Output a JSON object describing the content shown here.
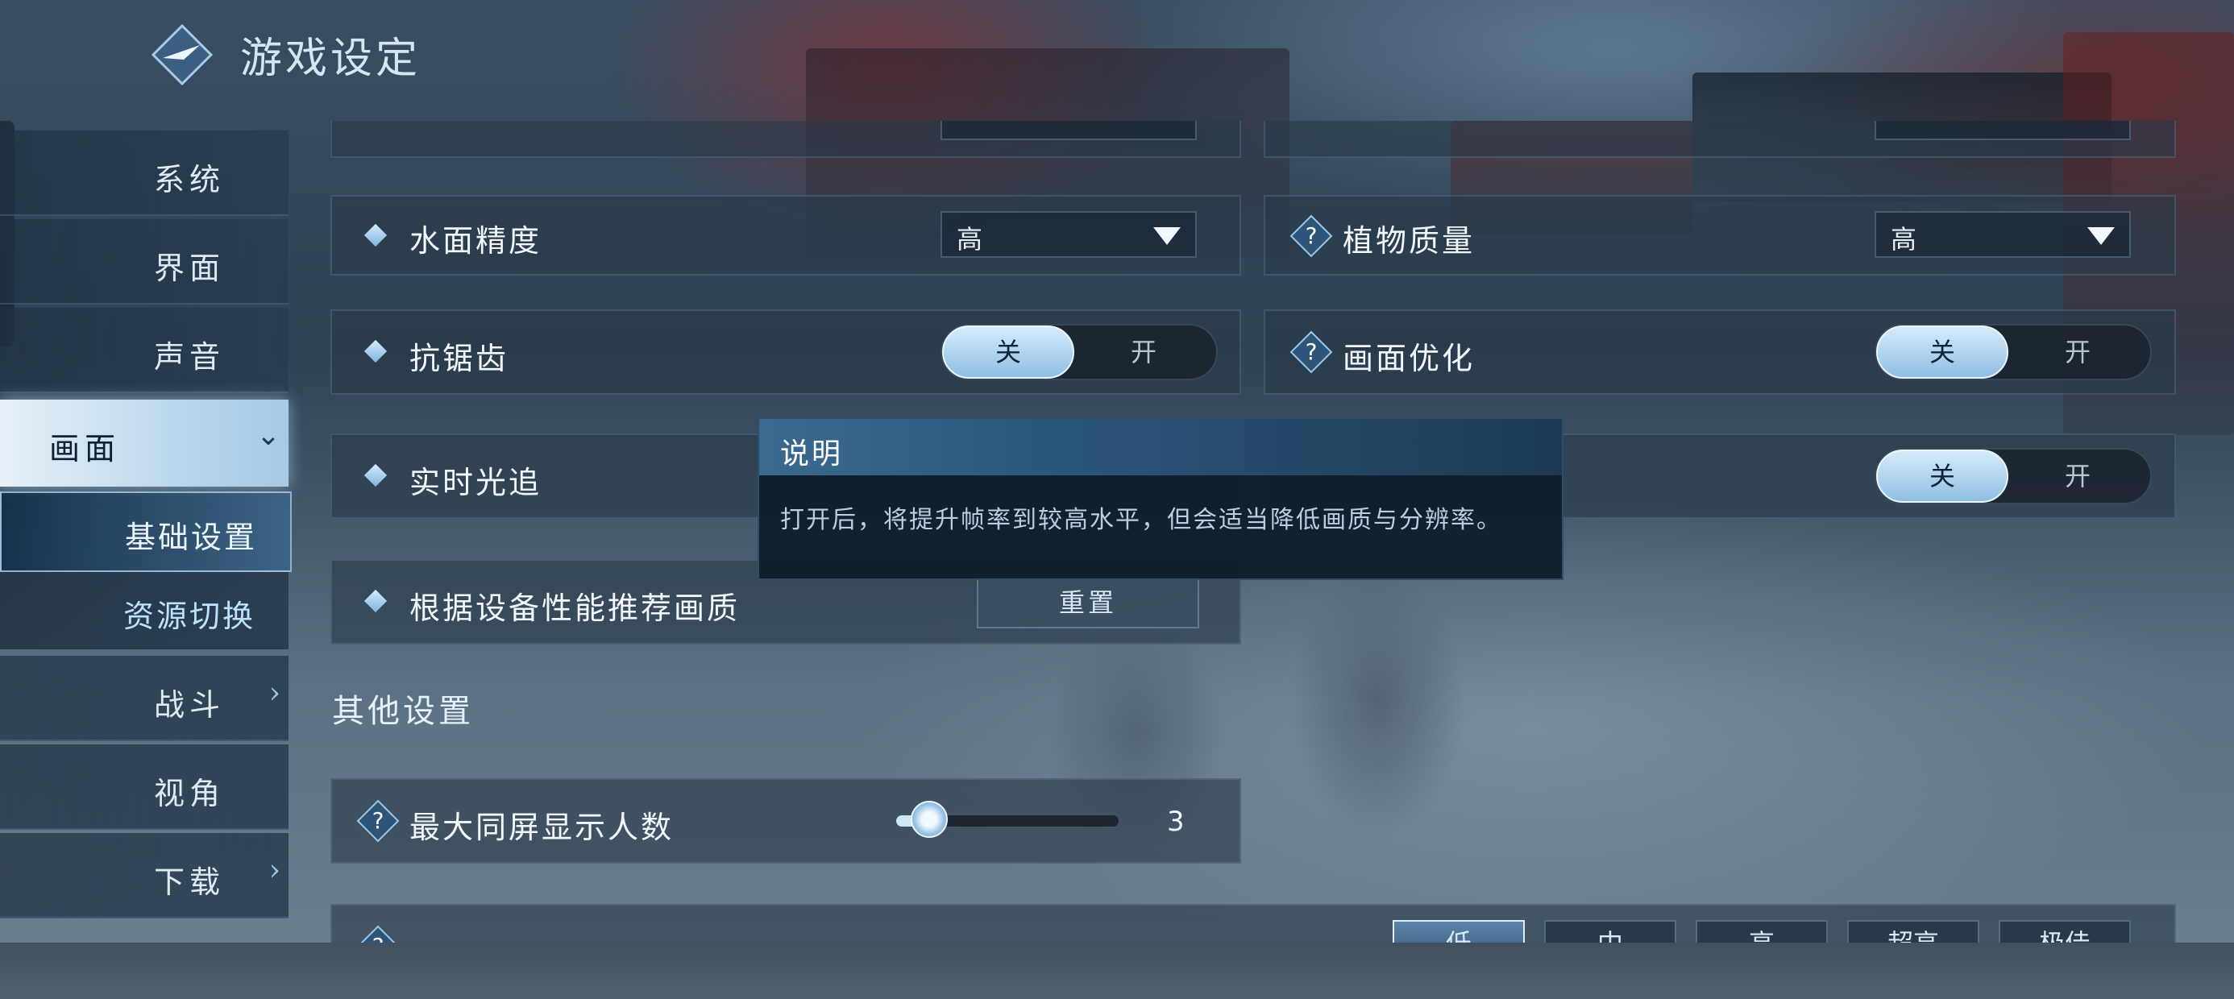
{
  "title": "游戏设定",
  "sidebar": {
    "items": [
      {
        "label": "系统"
      },
      {
        "label": "界面"
      },
      {
        "label": "声音"
      },
      {
        "label": "画面"
      },
      {
        "label": "战斗"
      },
      {
        "label": "视角"
      },
      {
        "label": "下载"
      }
    ],
    "subitems": [
      {
        "label": "基础设置"
      },
      {
        "label": "资源切换"
      }
    ],
    "active": "画面",
    "active_sub": "基础设置"
  },
  "settings": {
    "water": {
      "label": "水面精度",
      "value": "高"
    },
    "plant": {
      "label": "植物质量",
      "value": "高"
    },
    "aa": {
      "label": "抗锯齿",
      "on": "关",
      "off": "开"
    },
    "opt": {
      "label": "画面优化",
      "on": "关",
      "off": "开"
    },
    "rt": {
      "label": "实时光追"
    },
    "rt_right": {
      "on": "关",
      "off": "开"
    },
    "recommend": {
      "label": "根据设备性能推荐画质",
      "button": "重置"
    }
  },
  "other": {
    "section_title": "其他设置",
    "max_players": {
      "label": "最大同屏显示人数",
      "value": "3",
      "fill_fraction": 0.15
    },
    "effects_segments": [
      "低",
      "中",
      "高",
      "超高",
      "极佳"
    ]
  },
  "tooltip": {
    "title": "说明",
    "body": "打开后，将提升帧率到较高水平，但会适当降低画质与分辨率。"
  },
  "colors": {
    "accent": "#8fbfe4",
    "panel": "#283848"
  }
}
